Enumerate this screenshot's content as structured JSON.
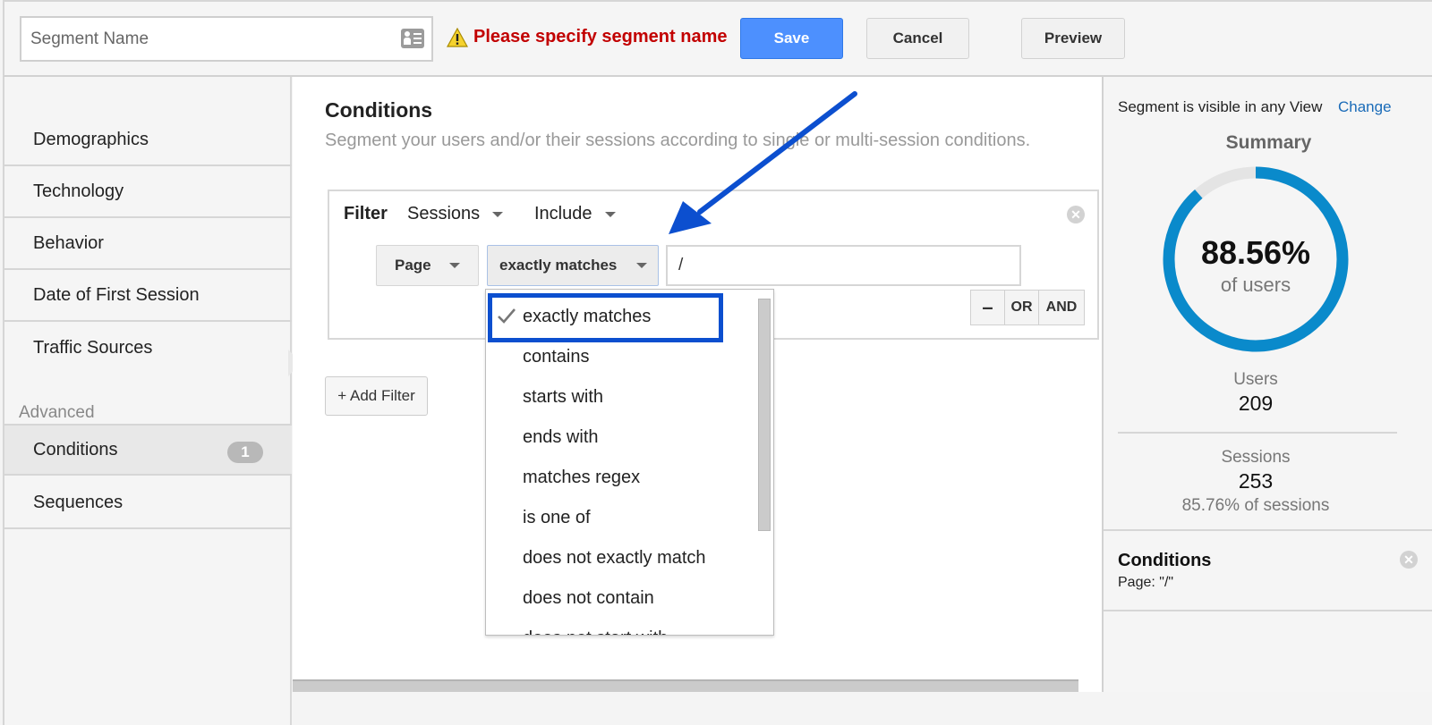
{
  "toolbar": {
    "segment_name_placeholder": "Segment Name",
    "segment_name_value": "",
    "warning_text": "Please specify segment name",
    "save_label": "Save",
    "cancel_label": "Cancel",
    "preview_label": "Preview"
  },
  "sidebar": {
    "items": [
      {
        "label": "Demographics"
      },
      {
        "label": "Technology"
      },
      {
        "label": "Behavior"
      },
      {
        "label": "Date of First Session"
      },
      {
        "label": "Traffic Sources"
      }
    ],
    "advanced_heading": "Advanced",
    "advanced_items": [
      {
        "label": "Conditions",
        "badge": "1",
        "active": true
      },
      {
        "label": "Sequences"
      }
    ]
  },
  "main": {
    "title": "Conditions",
    "subtitle": "Segment your users and/or their sessions according to single or multi-session conditions.",
    "filter": {
      "label": "Filter",
      "scope": "Sessions",
      "mode": "Include",
      "dimension": "Page",
      "match_type": "exactly matches",
      "value": "/",
      "logic_minus": "–",
      "logic_or": "OR",
      "logic_and": "AND"
    },
    "add_filter_label": "+ Add Filter",
    "match_options": [
      {
        "label": "exactly matches",
        "selected": true
      },
      {
        "label": "contains"
      },
      {
        "label": "starts with"
      },
      {
        "label": "ends with"
      },
      {
        "label": "matches regex"
      },
      {
        "label": "is one of"
      },
      {
        "label": "does not exactly match"
      },
      {
        "label": "does not contain"
      },
      {
        "label": "does not start with"
      }
    ]
  },
  "summary": {
    "visibility_text": "Segment is visible in any View",
    "change_label": "Change",
    "title": "Summary",
    "users_pct_value": 88.56,
    "users_pct": "88.56%",
    "users_pct_caption": "of users",
    "users_label": "Users",
    "users_value": "209",
    "sessions_label": "Sessions",
    "sessions_value": "253",
    "sessions_pct": "85.76% of sessions",
    "conditions_title": "Conditions",
    "conditions_desc": "Page: \"/\""
  },
  "colors": {
    "accent": "#4d90fe",
    "warning": "#c20000",
    "donut": "#0a8acb",
    "annotation": "#0c4fcf",
    "link": "#1a6bb8"
  }
}
